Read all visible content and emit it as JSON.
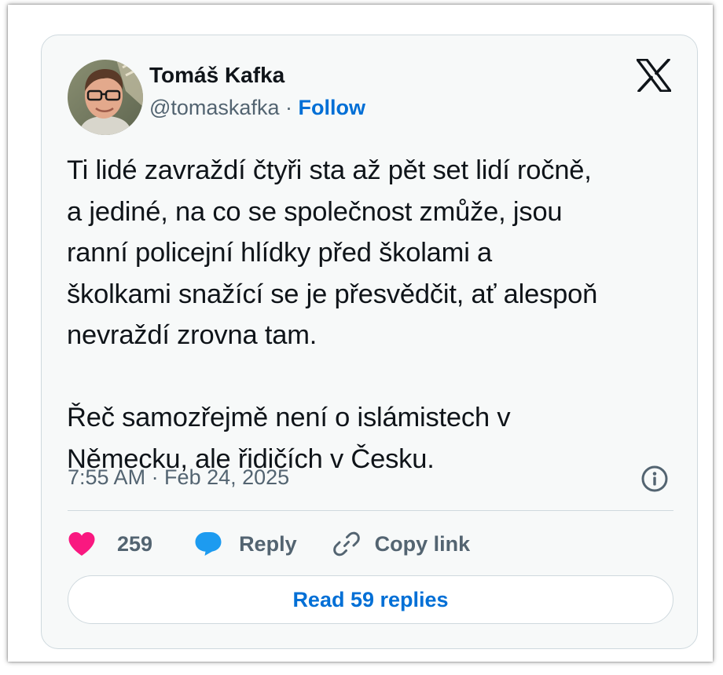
{
  "author": {
    "name": "Tomáš Kafka",
    "handle": "@tomaskafka",
    "separator": " · ",
    "follow_label": "Follow"
  },
  "tweet": {
    "text": "Ti lidé zavraždí čtyři sta až pět set lidí ročně,\na jediné, na co se společnost zmůže, jsou\nranní policejní hlídky před školami a\nškolkami snažící se je přesvědčit, ať alespoň\nnevraždí zrovna tam.\n\nŘeč samozřejmě není o islámistech v\nNěmecku, ale řidičích v Česku.",
    "timestamp": "7:55 AM · Feb 24, 2025"
  },
  "actions": {
    "like_count": "259",
    "reply_label": "Reply",
    "copy_link_label": "Copy link"
  },
  "read_replies_label": "Read 59 replies",
  "icons": {
    "brand": "x-logo-icon",
    "like": "heart-icon",
    "reply": "speech-bubble-icon",
    "copy": "link-icon",
    "info": "info-icon"
  },
  "colors": {
    "card_background": "#f7f9f9",
    "border": "#cfd9de",
    "primary_text": "#0f1419",
    "secondary_text": "#536471",
    "link_blue": "#006fd6",
    "like_pink": "#f91880",
    "reply_blue": "#1d9bf0"
  }
}
